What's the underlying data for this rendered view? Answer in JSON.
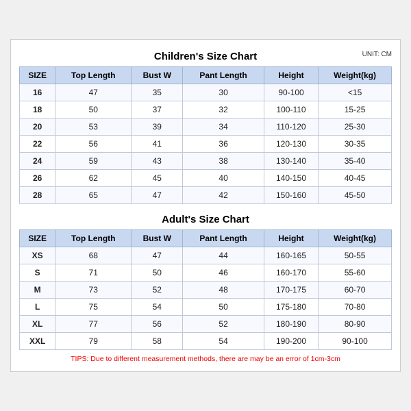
{
  "children_title": "Children's Size Chart",
  "adult_title": "Adult's Size Chart",
  "unit_label": "UNIT: CM",
  "columns": [
    "SIZE",
    "Top Length",
    "Bust W",
    "Pant Length",
    "Height",
    "Weight(kg)"
  ],
  "children_rows": [
    [
      "16",
      "47",
      "35",
      "30",
      "90-100",
      "<15"
    ],
    [
      "18",
      "50",
      "37",
      "32",
      "100-110",
      "15-25"
    ],
    [
      "20",
      "53",
      "39",
      "34",
      "110-120",
      "25-30"
    ],
    [
      "22",
      "56",
      "41",
      "36",
      "120-130",
      "30-35"
    ],
    [
      "24",
      "59",
      "43",
      "38",
      "130-140",
      "35-40"
    ],
    [
      "26",
      "62",
      "45",
      "40",
      "140-150",
      "40-45"
    ],
    [
      "28",
      "65",
      "47",
      "42",
      "150-160",
      "45-50"
    ]
  ],
  "adult_rows": [
    [
      "XS",
      "68",
      "47",
      "44",
      "160-165",
      "50-55"
    ],
    [
      "S",
      "71",
      "50",
      "46",
      "160-170",
      "55-60"
    ],
    [
      "M",
      "73",
      "52",
      "48",
      "170-175",
      "60-70"
    ],
    [
      "L",
      "75",
      "54",
      "50",
      "175-180",
      "70-80"
    ],
    [
      "XL",
      "77",
      "56",
      "52",
      "180-190",
      "80-90"
    ],
    [
      "XXL",
      "79",
      "58",
      "54",
      "190-200",
      "90-100"
    ]
  ],
  "tips": "TIPS: Due to different measurement methods, there are may be an error of 1cm-3cm"
}
